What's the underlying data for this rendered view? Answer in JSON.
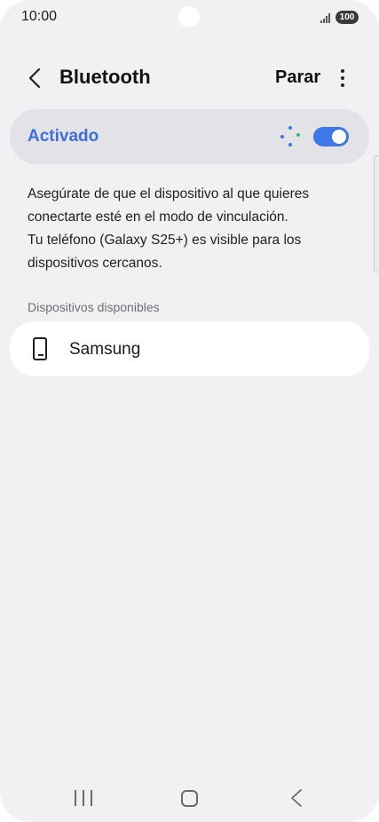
{
  "status_bar": {
    "time": "10:00",
    "battery": "100",
    "icons": [
      "signal-icon",
      "battery-icon"
    ]
  },
  "header": {
    "title": "Bluetooth",
    "stop_label": "Parar",
    "icons": [
      "back-arrow-icon",
      "more-options-icon"
    ]
  },
  "bluetooth_toggle": {
    "label": "Activado",
    "enabled": true,
    "scanning": true,
    "accent_color": "#3e78e6"
  },
  "description": {
    "lines": [
      "Asegúrate de que el dispositivo al que quieres",
      "conectarte esté en el modo de vinculación.",
      "Tu teléfono (Galaxy S25+) es visible para los",
      "dispositivos cercanos."
    ]
  },
  "available_devices": {
    "header": "Dispositivos disponibles",
    "items": [
      {
        "name": "Samsung",
        "icon": "phone-icon"
      }
    ]
  },
  "nav_bar": {
    "icons": [
      "recent-apps-icon",
      "home-icon",
      "back-icon"
    ]
  }
}
